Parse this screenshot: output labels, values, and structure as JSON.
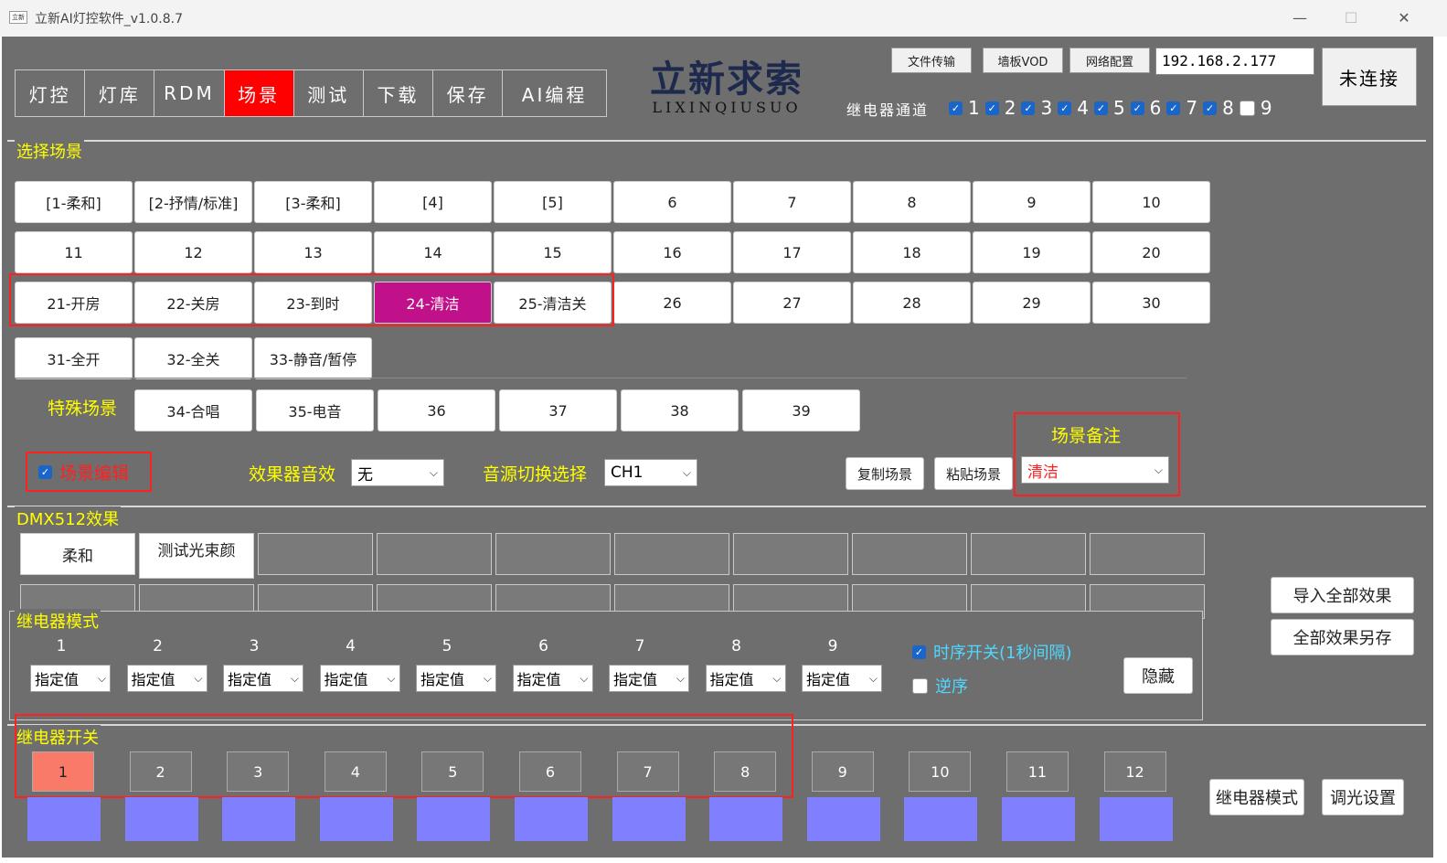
{
  "window": {
    "title": "立新AI灯控软件_v1.0.8.7",
    "icon_text": "立新",
    "minimize": "—",
    "maximize": "☐",
    "close": "✕"
  },
  "tabs": [
    {
      "label": "灯控"
    },
    {
      "label": "灯库"
    },
    {
      "label": "RDM"
    },
    {
      "label": "场景",
      "active": true
    },
    {
      "label": "测试"
    },
    {
      "label": "下载"
    },
    {
      "label": "保存"
    },
    {
      "label": "AI编程"
    }
  ],
  "logo": {
    "cn": "立新求索",
    "en": "LIXINQIUSUO"
  },
  "toolbar": {
    "file_transfer": "文件传输",
    "wall_vod": "墙板VOD",
    "network_config": "网络配置",
    "ip": "192.168.2.177",
    "connection": "未连接"
  },
  "relay_channels": {
    "label": "继电器通道",
    "items": [
      {
        "n": "1",
        "checked": true
      },
      {
        "n": "2",
        "checked": true
      },
      {
        "n": "3",
        "checked": true
      },
      {
        "n": "4",
        "checked": true
      },
      {
        "n": "5",
        "checked": true
      },
      {
        "n": "6",
        "checked": true
      },
      {
        "n": "7",
        "checked": true
      },
      {
        "n": "8",
        "checked": true
      },
      {
        "n": "9",
        "checked": false
      }
    ]
  },
  "scene_section": {
    "title": "选择场景",
    "rows": [
      [
        "[1-柔和]",
        "[2-抒情/标准]",
        "[3-柔和]",
        "[4]",
        "[5]",
        "6",
        "7",
        "8",
        "9",
        "10"
      ],
      [
        "11",
        "12",
        "13",
        "14",
        "15",
        "16",
        "17",
        "18",
        "19",
        "20"
      ],
      [
        "21-开房",
        "22-关房",
        "23-到时",
        "24-清洁",
        "25-清洁关",
        "26",
        "27",
        "28",
        "29",
        "30"
      ],
      [
        "31-全开",
        "32-全关",
        "33-静音/暂停"
      ]
    ],
    "active_scene": "24-清洁",
    "special_label": "特殊场景",
    "special": [
      "34-合唱",
      "35-电音",
      "36",
      "37",
      "38",
      "39"
    ],
    "edit_label": "场景编辑",
    "effect_label": "效果器音效",
    "effect_value": "无",
    "source_label": "音源切换选择",
    "source_value": "CH1",
    "copy_label": "复制场景",
    "paste_label": "粘贴场景",
    "note_label": "场景备注",
    "note_value": "清洁"
  },
  "dmx_section": {
    "title": "DMX512效果",
    "effects": [
      "柔和",
      "测试光束颜"
    ],
    "import_all": "导入全部效果",
    "save_all_as": "全部效果另存"
  },
  "relay_mode_section": {
    "title": "继电器模式",
    "channels": [
      "1",
      "2",
      "3",
      "4",
      "5",
      "6",
      "7",
      "8",
      "9"
    ],
    "mode_value": "指定值",
    "timing_label": "时序开关(1秒间隔)",
    "reverse_label": "逆序",
    "hide_label": "隐藏"
  },
  "relay_switch_section": {
    "title": "继电器开关",
    "buttons": [
      "1",
      "2",
      "3",
      "4",
      "5",
      "6",
      "7",
      "8",
      "9",
      "10",
      "11",
      "12"
    ],
    "on": [
      "1"
    ],
    "relay_mode_btn": "继电器模式",
    "dimming_btn": "调光设置"
  },
  "colors": {
    "accent_red": "#ff0000",
    "active_scene": "#c0108a",
    "panel_bg": "#6e6e6e",
    "title_yellow": "#ffff00",
    "relay_bar": "#8080ff",
    "relay_on": "#fa7a6a"
  }
}
